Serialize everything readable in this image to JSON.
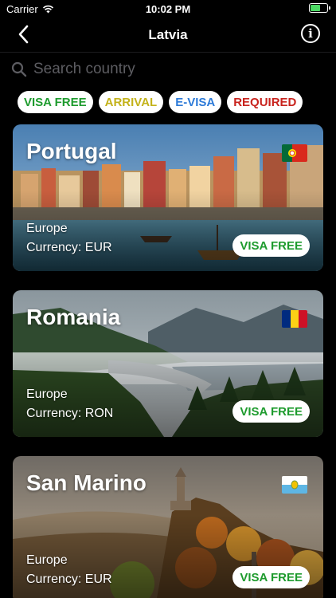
{
  "status_bar": {
    "carrier": "Carrier",
    "time": "10:02 PM",
    "icons": [
      "wifi-icon",
      "battery-icon"
    ]
  },
  "nav": {
    "title": "Latvia",
    "back_icon": "chevron-left-icon",
    "info_icon": "info-icon"
  },
  "search": {
    "placeholder": "Search country",
    "value": "",
    "icon": "search-icon"
  },
  "filters": [
    {
      "label": "VISA FREE",
      "color": "#1e9b2e"
    },
    {
      "label": "ARRIVAL",
      "color": "#c3b21a"
    },
    {
      "label": "E-VISA",
      "color": "#2c7ad8"
    },
    {
      "label": "REQUIRED",
      "color": "#c8231d"
    }
  ],
  "countries": [
    {
      "name": "Portugal",
      "region": "Europe",
      "currency": "Currency: EUR",
      "status": "VISA FREE",
      "flag_icon": "portugal-flag-icon"
    },
    {
      "name": "Romania",
      "region": "Europe",
      "currency": "Currency: RON",
      "status": "VISA FREE",
      "flag_icon": "romania-flag-icon"
    },
    {
      "name": "San Marino",
      "region": "Europe",
      "currency": "Currency: EUR",
      "status": "VISA FREE",
      "flag_icon": "san-marino-flag-icon"
    }
  ]
}
